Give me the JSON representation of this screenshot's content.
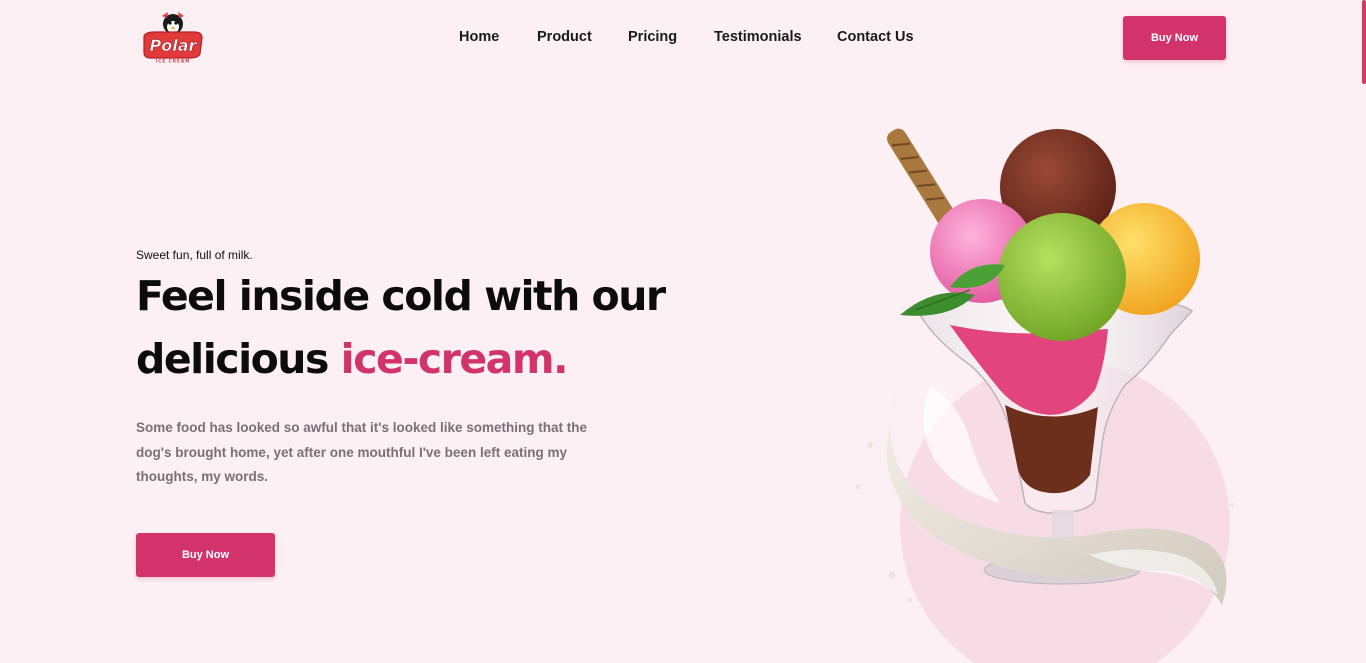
{
  "brand": {
    "name": "Polar",
    "tagline": "ICE CREAM"
  },
  "nav": {
    "items": [
      "Home",
      "Product",
      "Pricing",
      "Testimonials",
      "Contact Us"
    ]
  },
  "header": {
    "cta_label": "Buy Now"
  },
  "hero": {
    "eyebrow": "Sweet fun, full of milk.",
    "headline_part1": "Feel inside cold with our delicious ",
    "headline_accent": "ice-cream.",
    "description": "Some food has looked so awful that it's looked like something that the dog's brought home, yet after one mouthful I've been left eating my thoughts, my words.",
    "cta_label": "Buy Now",
    "image_icon": "ice-cream-sundae-illustration"
  },
  "colors": {
    "accent": "#d1336a",
    "background": "#fcf0f4",
    "circle": "#f7dce6",
    "text_dark": "#0c0c0c",
    "text_muted": "#7a6f75"
  }
}
